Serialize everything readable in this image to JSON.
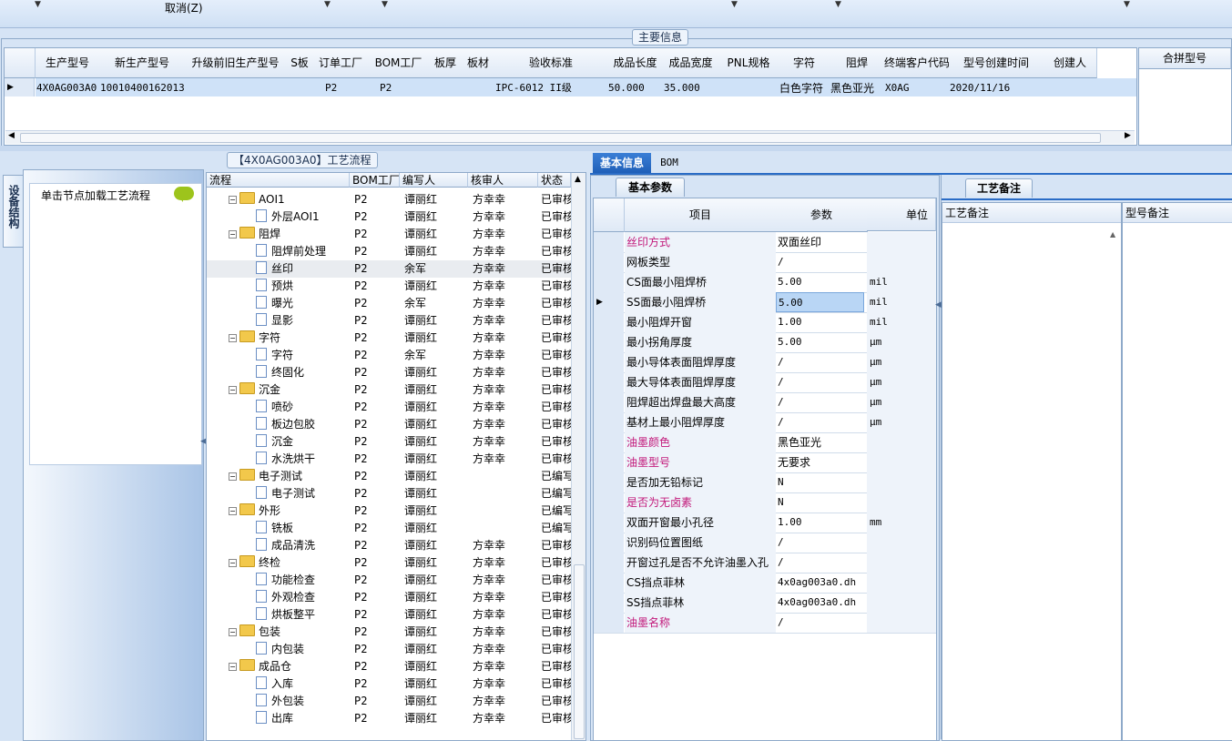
{
  "toolbar": {
    "cancel_label": "取消(Z)"
  },
  "main_info": {
    "legend": "主要信息",
    "columns": [
      "生产型号",
      "新生产型号",
      "升级前旧生产型号",
      "S板",
      "订单工厂",
      "BOM工厂",
      "板厚",
      "板材",
      "验收标准",
      "成品长度",
      "成品宽度",
      "PNL规格",
      "字符",
      "阻焊",
      "终端客户代码",
      "型号创建时间",
      "创建人"
    ],
    "row": {
      "c0": "4X0AG003A0",
      "c1": "10010400162013",
      "c4": "P2",
      "c5": "P2",
      "c8": "IPC-6012 II级",
      "c9": "50.000",
      "c10": "35.000",
      "c12": "白色字符",
      "c13": "黑色亚光",
      "c14": "X0AG",
      "c15": "2020/11/16"
    },
    "merge_header": "合拼型号"
  },
  "side": {
    "tab_label": "设备结构",
    "hint": "单击节点加载工艺流程"
  },
  "flow": {
    "legend": "【4X0AG003A0】工艺流程",
    "columns": [
      "流程",
      "BOM工厂",
      "编写人",
      "核审人",
      "状态"
    ],
    "rows": [
      {
        "t": "f",
        "name": "AOI1",
        "bom": "P2",
        "w": "谭丽红",
        "r": "方幸幸",
        "s": "已审核"
      },
      {
        "t": "d",
        "name": "外层AOI1",
        "bom": "P2",
        "w": "谭丽红",
        "r": "方幸幸",
        "s": "已审核"
      },
      {
        "t": "f",
        "name": "阻焊",
        "bom": "P2",
        "w": "谭丽红",
        "r": "方幸幸",
        "s": "已审核"
      },
      {
        "t": "d",
        "name": "阻焊前处理",
        "bom": "P2",
        "w": "谭丽红",
        "r": "方幸幸",
        "s": "已审核"
      },
      {
        "t": "d",
        "name": "丝印",
        "bom": "P2",
        "w": "余军",
        "r": "方幸幸",
        "s": "已审核",
        "sel": true
      },
      {
        "t": "d",
        "name": "预烘",
        "bom": "P2",
        "w": "谭丽红",
        "r": "方幸幸",
        "s": "已审核"
      },
      {
        "t": "d",
        "name": "曝光",
        "bom": "P2",
        "w": "余军",
        "r": "方幸幸",
        "s": "已审核"
      },
      {
        "t": "d",
        "name": "显影",
        "bom": "P2",
        "w": "谭丽红",
        "r": "方幸幸",
        "s": "已审核"
      },
      {
        "t": "f",
        "name": "字符",
        "bom": "P2",
        "w": "谭丽红",
        "r": "方幸幸",
        "s": "已审核"
      },
      {
        "t": "d",
        "name": "字符",
        "bom": "P2",
        "w": "余军",
        "r": "方幸幸",
        "s": "已审核"
      },
      {
        "t": "d",
        "name": "终固化",
        "bom": "P2",
        "w": "谭丽红",
        "r": "方幸幸",
        "s": "已审核"
      },
      {
        "t": "f",
        "name": "沉金",
        "bom": "P2",
        "w": "谭丽红",
        "r": "方幸幸",
        "s": "已审核"
      },
      {
        "t": "d",
        "name": "喷砂",
        "bom": "P2",
        "w": "谭丽红",
        "r": "方幸幸",
        "s": "已审核"
      },
      {
        "t": "d",
        "name": "板边包胶",
        "bom": "P2",
        "w": "谭丽红",
        "r": "方幸幸",
        "s": "已审核"
      },
      {
        "t": "d",
        "name": "沉金",
        "bom": "P2",
        "w": "谭丽红",
        "r": "方幸幸",
        "s": "已审核"
      },
      {
        "t": "d",
        "name": "水洗烘干",
        "bom": "P2",
        "w": "谭丽红",
        "r": "方幸幸",
        "s": "已审核"
      },
      {
        "t": "f",
        "name": "电子测试",
        "bom": "P2",
        "w": "谭丽红",
        "r": "",
        "s": "已编写"
      },
      {
        "t": "d",
        "name": "电子测试",
        "bom": "P2",
        "w": "谭丽红",
        "r": "",
        "s": "已编写"
      },
      {
        "t": "f",
        "name": "外形",
        "bom": "P2",
        "w": "谭丽红",
        "r": "",
        "s": "已编写"
      },
      {
        "t": "d",
        "name": "铣板",
        "bom": "P2",
        "w": "谭丽红",
        "r": "",
        "s": "已编写"
      },
      {
        "t": "d",
        "name": "成品清洗",
        "bom": "P2",
        "w": "谭丽红",
        "r": "方幸幸",
        "s": "已审核"
      },
      {
        "t": "f",
        "name": "终检",
        "bom": "P2",
        "w": "谭丽红",
        "r": "方幸幸",
        "s": "已审核"
      },
      {
        "t": "d",
        "name": "功能检查",
        "bom": "P2",
        "w": "谭丽红",
        "r": "方幸幸",
        "s": "已审核"
      },
      {
        "t": "d",
        "name": "外观检查",
        "bom": "P2",
        "w": "谭丽红",
        "r": "方幸幸",
        "s": "已审核"
      },
      {
        "t": "d",
        "name": "烘板整平",
        "bom": "P2",
        "w": "谭丽红",
        "r": "方幸幸",
        "s": "已审核"
      },
      {
        "t": "f",
        "name": "包装",
        "bom": "P2",
        "w": "谭丽红",
        "r": "方幸幸",
        "s": "已审核"
      },
      {
        "t": "d",
        "name": "内包装",
        "bom": "P2",
        "w": "谭丽红",
        "r": "方幸幸",
        "s": "已审核"
      },
      {
        "t": "f",
        "name": "成品仓",
        "bom": "P2",
        "w": "谭丽红",
        "r": "方幸幸",
        "s": "已审核"
      },
      {
        "t": "d",
        "name": "入库",
        "bom": "P2",
        "w": "谭丽红",
        "r": "方幸幸",
        "s": "已审核"
      },
      {
        "t": "d",
        "name": "外包装",
        "bom": "P2",
        "w": "谭丽红",
        "r": "方幸幸",
        "s": "已审核"
      },
      {
        "t": "d",
        "name": "出库",
        "bom": "P2",
        "w": "谭丽红",
        "r": "方幸幸",
        "s": "已审核"
      }
    ]
  },
  "tabs": {
    "basic": "基本信息",
    "bom": "BOM",
    "params": "基本参数",
    "remarks": "工艺备注"
  },
  "params": {
    "columns": [
      "项目",
      "参数",
      "单位"
    ],
    "rows": [
      {
        "item": "丝印方式",
        "value": "双面丝印",
        "unit": "",
        "pink": true
      },
      {
        "item": "网板类型",
        "value": "/",
        "unit": ""
      },
      {
        "item": "CS面最小阻焊桥",
        "value": "5.00",
        "unit": "mil"
      },
      {
        "item": "SS面最小阻焊桥",
        "value": "5.00",
        "unit": "mil",
        "cur": true
      },
      {
        "item": "最小阻焊开窗",
        "value": "1.00",
        "unit": "mil"
      },
      {
        "item": "最小拐角厚度",
        "value": "5.00",
        "unit": "μm"
      },
      {
        "item": "最小导体表面阻焊厚度",
        "value": "/",
        "unit": "μm"
      },
      {
        "item": "最大导体表面阻焊厚度",
        "value": "/",
        "unit": "μm"
      },
      {
        "item": "阻焊超出焊盘最大高度",
        "value": "/",
        "unit": "μm"
      },
      {
        "item": "基材上最小阻焊厚度",
        "value": "/",
        "unit": "μm"
      },
      {
        "item": "油墨颜色",
        "value": "黑色亚光",
        "unit": "",
        "pink": true
      },
      {
        "item": "油墨型号",
        "value": "无要求",
        "unit": "",
        "pink": true
      },
      {
        "item": "是否加无铅标记",
        "value": "N",
        "unit": ""
      },
      {
        "item": "是否为无卤素",
        "value": "N",
        "unit": "",
        "pink": true
      },
      {
        "item": "双面开窗最小孔径",
        "value": "1.00",
        "unit": "mm"
      },
      {
        "item": "识别码位置图纸",
        "value": "/",
        "unit": ""
      },
      {
        "item": "开窗过孔是否不允许油墨入孔",
        "value": "/",
        "unit": ""
      },
      {
        "item": "CS挡点菲林",
        "value": "4x0ag003a0.dh",
        "unit": ""
      },
      {
        "item": "SS挡点菲林",
        "value": "4x0ag003a0.dh",
        "unit": ""
      },
      {
        "item": "油墨名称",
        "value": "/",
        "unit": "",
        "pink": true
      }
    ]
  },
  "remarks": {
    "col1": "工艺备注",
    "col2": "型号备注"
  }
}
